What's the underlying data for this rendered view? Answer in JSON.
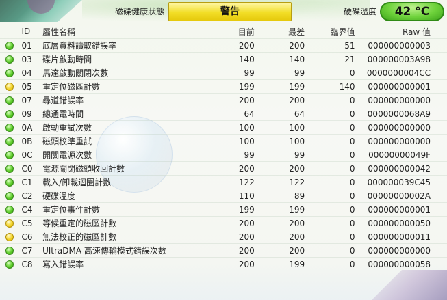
{
  "status": {
    "health_label": "磁碟健康狀態",
    "health_value": "警告",
    "temp_label": "硬碟溫度",
    "temp_value": "42 °C"
  },
  "table": {
    "headers": {
      "id": "ID",
      "name": "屬性名稱",
      "current": "目前",
      "worst": "最差",
      "threshold": "臨界值",
      "raw": "Raw 值"
    },
    "rows": [
      {
        "status": "good",
        "id": "01",
        "name": "底層資料讀取錯誤率",
        "current": "200",
        "worst": "200",
        "threshold": "51",
        "raw": "000000000003"
      },
      {
        "status": "good",
        "id": "03",
        "name": "碟片啟動時間",
        "current": "140",
        "worst": "140",
        "threshold": "21",
        "raw": "000000003A98"
      },
      {
        "status": "good",
        "id": "04",
        "name": "馬達啟動關閉次數",
        "current": "99",
        "worst": "99",
        "threshold": "0",
        "raw": "0000000004CC"
      },
      {
        "status": "caution",
        "id": "05",
        "name": "重定位磁區計數",
        "current": "199",
        "worst": "199",
        "threshold": "140",
        "raw": "000000000001"
      },
      {
        "status": "good",
        "id": "07",
        "name": "尋道錯誤率",
        "current": "200",
        "worst": "200",
        "threshold": "0",
        "raw": "000000000000"
      },
      {
        "status": "good",
        "id": "09",
        "name": "總通電時間",
        "current": "64",
        "worst": "64",
        "threshold": "0",
        "raw": "0000000068A9"
      },
      {
        "status": "good",
        "id": "0A",
        "name": "啟動重試次數",
        "current": "100",
        "worst": "100",
        "threshold": "0",
        "raw": "000000000000"
      },
      {
        "status": "good",
        "id": "0B",
        "name": "磁頭校準重試",
        "current": "100",
        "worst": "100",
        "threshold": "0",
        "raw": "000000000000"
      },
      {
        "status": "good",
        "id": "0C",
        "name": "開關電源次數",
        "current": "99",
        "worst": "99",
        "threshold": "0",
        "raw": "00000000049F"
      },
      {
        "status": "good",
        "id": "C0",
        "name": "電源關閉磁頭收回計數",
        "current": "200",
        "worst": "200",
        "threshold": "0",
        "raw": "000000000042"
      },
      {
        "status": "good",
        "id": "C1",
        "name": "載入/卸載迴圈計數",
        "current": "122",
        "worst": "122",
        "threshold": "0",
        "raw": "000000039C45"
      },
      {
        "status": "good",
        "id": "C2",
        "name": "硬碟溫度",
        "current": "110",
        "worst": "89",
        "threshold": "0",
        "raw": "00000000002A"
      },
      {
        "status": "good",
        "id": "C4",
        "name": "重定位事件計數",
        "current": "199",
        "worst": "199",
        "threshold": "0",
        "raw": "000000000001"
      },
      {
        "status": "caution",
        "id": "C5",
        "name": "等候重定的磁區計數",
        "current": "200",
        "worst": "200",
        "threshold": "0",
        "raw": "000000000050"
      },
      {
        "status": "caution",
        "id": "C6",
        "name": "無法校正的磁區計數",
        "current": "200",
        "worst": "200",
        "threshold": "0",
        "raw": "000000000011"
      },
      {
        "status": "good",
        "id": "C7",
        "name": "UltraDMA 高速傳輸模式錯誤次數",
        "current": "200",
        "worst": "200",
        "threshold": "0",
        "raw": "000000000000"
      },
      {
        "status": "good",
        "id": "C8",
        "name": "寫入錯誤率",
        "current": "200",
        "worst": "199",
        "threshold": "0",
        "raw": "000000000058"
      }
    ]
  },
  "colors": {
    "status_caution": "#f2de27",
    "temp_good": "#6ed23b",
    "dot_good": "#5fcf2a",
    "dot_caution": "#f4d52a"
  }
}
